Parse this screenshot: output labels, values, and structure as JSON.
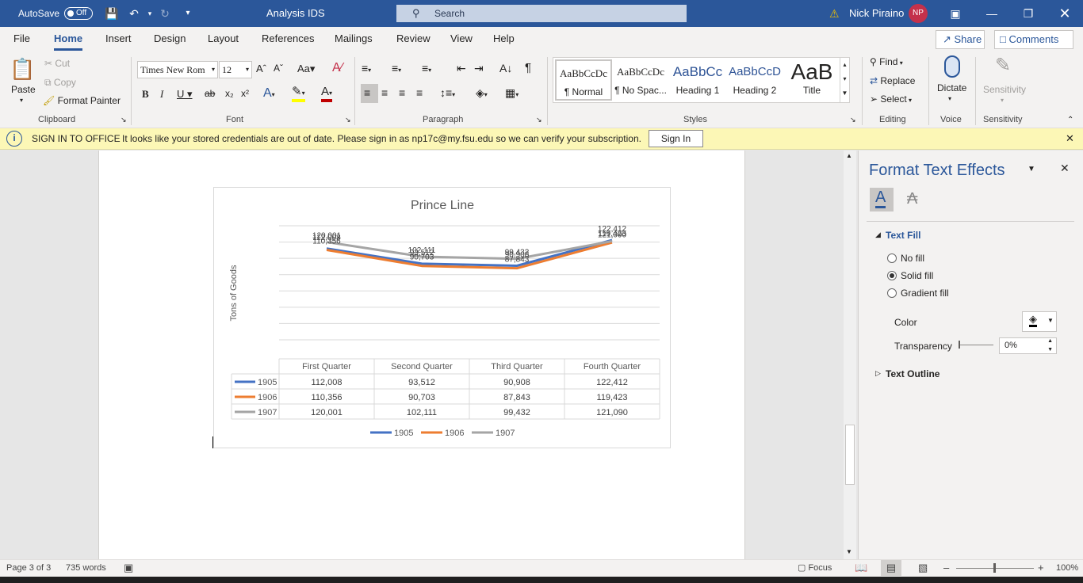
{
  "titlebar": {
    "autosave_label": "AutoSave",
    "autosave_state": "Off",
    "doc_title": "Analysis IDS",
    "search_placeholder": "Search",
    "user_name": "Nick Piraino",
    "user_initials": "NP"
  },
  "tabs": [
    "File",
    "Home",
    "Insert",
    "Design",
    "Layout",
    "References",
    "Mailings",
    "Review",
    "View",
    "Help"
  ],
  "active_tab": "Home",
  "share_label": "Share",
  "comments_label": "Comments",
  "clipboard": {
    "paste": "Paste",
    "cut": "Cut",
    "copy": "Copy",
    "format_painter": "Format Painter",
    "group": "Clipboard"
  },
  "font": {
    "name": "Times New Rom",
    "size": "12",
    "group": "Font"
  },
  "paragraph_group": "Paragraph",
  "styles": {
    "group": "Styles",
    "items": [
      {
        "preview": "AaBbCcDc",
        "name": "¶ Normal"
      },
      {
        "preview": "AaBbCcDc",
        "name": "¶ No Spac..."
      },
      {
        "preview": "AaBbCc",
        "name": "Heading 1"
      },
      {
        "preview": "AaBbCcD",
        "name": "Heading 2"
      },
      {
        "preview": "AaB",
        "name": "Title"
      }
    ]
  },
  "editing": {
    "find": "Find",
    "replace": "Replace",
    "select": "Select",
    "group": "Editing"
  },
  "voice": {
    "dictate": "Dictate",
    "group": "Voice"
  },
  "sensitivity": {
    "label": "Sensitivity",
    "group": "Sensitivity"
  },
  "infobar": {
    "heading": "SIGN IN TO OFFICE",
    "message": "It looks like your stored credentials are out of date. Please sign in as np17c@my.fsu.edu so we can verify your subscription.",
    "button": "Sign In"
  },
  "chart_data": {
    "type": "line",
    "title": "Prince Line",
    "ylabel": "Tons of Goods",
    "xlabel": "",
    "categories": [
      "First Quarter",
      "Second Quarter",
      "Third Quarter",
      "Fourth Quarter"
    ],
    "series": [
      {
        "name": "1905",
        "color": "#4472c4",
        "values": [
          112008,
          93512,
          90908,
          122412
        ],
        "labels": [
          "112,008",
          "93,512",
          "90,908",
          "122,412"
        ]
      },
      {
        "name": "1906",
        "color": "#ed7d31",
        "values": [
          110356,
          90703,
          87843,
          119423
        ],
        "labels": [
          "110,356",
          "90,703",
          "87,843",
          "119,423"
        ]
      },
      {
        "name": "1907",
        "color": "#a5a5a5",
        "values": [
          120001,
          102111,
          99432,
          121090
        ],
        "labels": [
          "120,001",
          "102,111",
          "99,432",
          "121,090"
        ]
      }
    ],
    "ylim": [
      0,
      140000
    ],
    "grid": true,
    "legend": "bottom",
    "data_table": true
  },
  "pane": {
    "title": "Format Text Effects",
    "section_fill": "Text Fill",
    "no_fill": "No fill",
    "solid_fill": "Solid fill",
    "gradient_fill": "Gradient fill",
    "selected_fill": "Solid fill",
    "color_label": "Color",
    "transparency_label": "Transparency",
    "transparency_value": "0%",
    "section_outline": "Text Outline"
  },
  "status": {
    "page": "Page 3 of 3",
    "words": "735 words",
    "focus": "Focus",
    "zoom": "100%"
  }
}
